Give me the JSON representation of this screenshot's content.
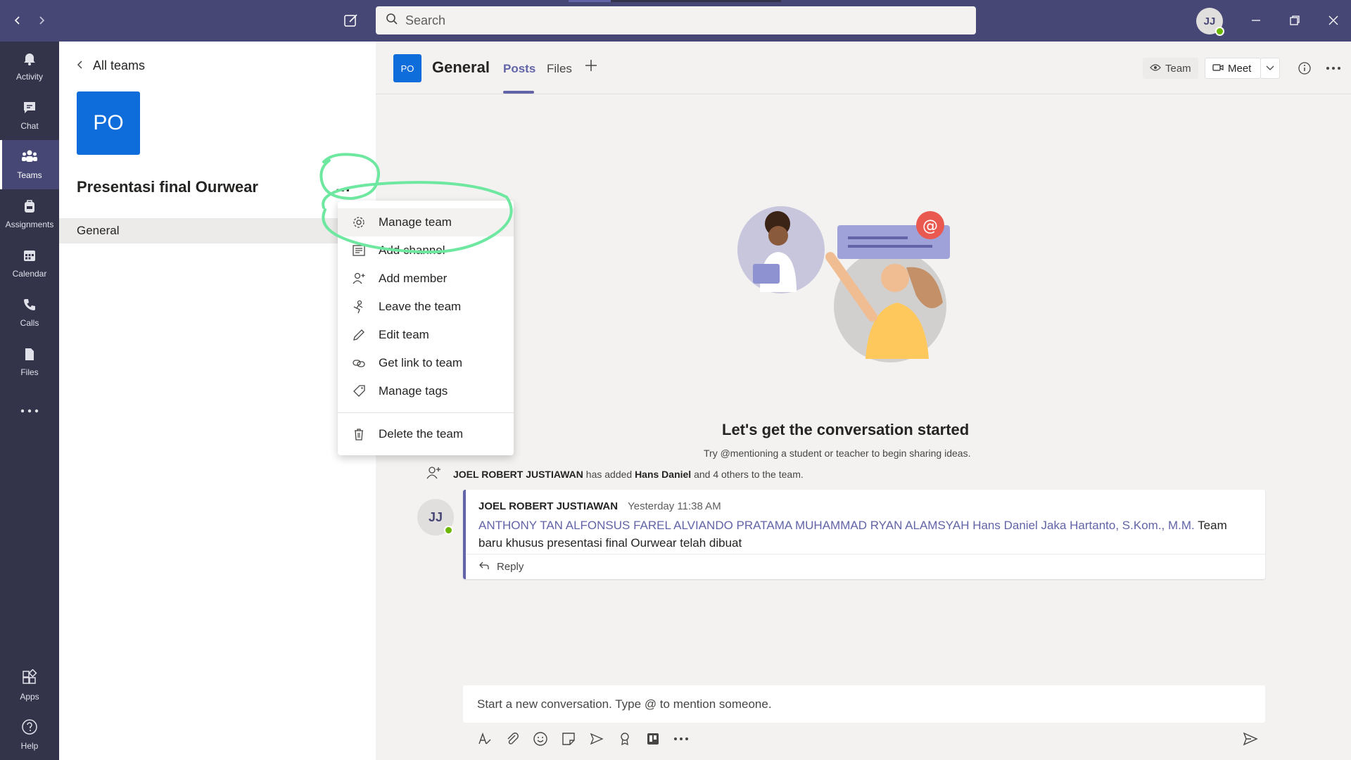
{
  "titlebar": {
    "search_placeholder": "Search",
    "user_initials": "JJ"
  },
  "rail": [
    {
      "label": "Activity",
      "icon": "bell-icon"
    },
    {
      "label": "Chat",
      "icon": "chat-icon"
    },
    {
      "label": "Teams",
      "icon": "teams-icon",
      "active": true
    },
    {
      "label": "Assignments",
      "icon": "backpack-icon"
    },
    {
      "label": "Calendar",
      "icon": "calendar-icon"
    },
    {
      "label": "Calls",
      "icon": "phone-icon"
    },
    {
      "label": "Files",
      "icon": "file-icon"
    },
    {
      "label": "Apps",
      "icon": "apps-icon"
    },
    {
      "label": "Help",
      "icon": "help-icon"
    }
  ],
  "panel": {
    "back_label": "All teams",
    "team_initials": "PO",
    "team_name": "Presentasi final Ourwear",
    "more": "...",
    "channels": [
      "General"
    ]
  },
  "channel_header": {
    "initials": "PO",
    "title": "General",
    "tabs": [
      "Posts",
      "Files"
    ],
    "team_btn": "Team",
    "meet_btn": "Meet"
  },
  "menu": {
    "items": [
      {
        "label": "Manage team",
        "icon": "gear-icon"
      },
      {
        "label": "Add channel",
        "icon": "channel-icon"
      },
      {
        "label": "Add member",
        "icon": "add-person-icon"
      },
      {
        "label": "Leave the team",
        "icon": "leave-icon"
      },
      {
        "label": "Edit team",
        "icon": "pencil-icon"
      },
      {
        "label": "Get link to team",
        "icon": "link-icon"
      },
      {
        "label": "Manage tags",
        "icon": "tag-icon"
      },
      {
        "label": "Delete the team",
        "icon": "trash-icon"
      }
    ]
  },
  "empty_state": {
    "title": "Let's get the conversation started",
    "subtitle": "Try @mentioning a student or teacher to begin sharing ideas."
  },
  "system_message": {
    "actor": "JOEL ROBERT JUSTIAWAN",
    "text1": " has added ",
    "target": "Hans Daniel",
    "text2": " and 4 others to the team."
  },
  "post": {
    "avatar": "JJ",
    "author": "JOEL ROBERT JUSTIAWAN",
    "time": "Yesterday 11:38 AM",
    "mentions": "ANTHONY TAN ALFONSUS FAREL ALVIANDO PRATAMA MUHAMMAD RYAN ALAMSYAH Hans Daniel Jaka Hartanto, S.Kom., M.M.",
    "text": " Team baru khusus presentasi final Ourwear telah dibuat",
    "reply": "Reply"
  },
  "compose": {
    "placeholder": "Start a new conversation. Type @ to mention someone."
  },
  "colors": {
    "titlebar": "#464775",
    "rail": "#33344a",
    "accent": "#6264a7",
    "team_tile": "#0f6cdb",
    "annotation": "#6ee7a0"
  }
}
